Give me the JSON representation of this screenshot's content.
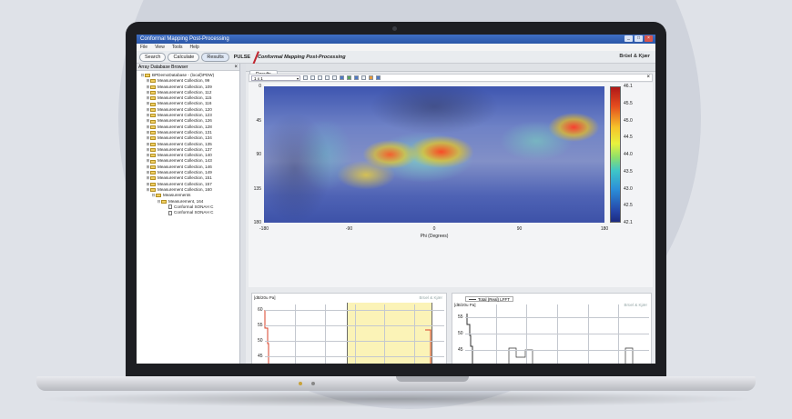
{
  "window": {
    "title": "Conformal Mapping Post-Processing",
    "buttons": {
      "minimize": "_",
      "maximize": "□",
      "close": "×"
    }
  },
  "menu": [
    "File",
    "View",
    "Tools",
    "Help"
  ],
  "toolbar": {
    "buttons": [
      "Search",
      "Calculate",
      "Results"
    ],
    "active": "Results",
    "mode_label": "PULSE",
    "app_title": "Conformal Mapping Post-Processing",
    "brand": "Brüel & Kjær"
  },
  "browser": {
    "title": "Array Database Browser",
    "close": "×",
    "root": "BPDemoDatabase - (local)\\PDW)",
    "collections": [
      "Measurement Collection, 99",
      "Measurement Collection, 109",
      "Measurement Collection, 112",
      "Measurement Collection, 115",
      "Measurement Collection, 116",
      "Measurement Collection, 120",
      "Measurement Collection, 123",
      "Measurement Collection, 126",
      "Measurement Collection, 128",
      "Measurement Collection, 131",
      "Measurement Collection, 134",
      "Measurement Collection, 135",
      "Measurement Collection, 137",
      "Measurement Collection, 140",
      "Measurement Collection, 143",
      "Measurement Collection, 146",
      "Measurement Collection, 149",
      "Measurement Collection, 151",
      "Measurement Collection, 157",
      "Measurement Collection, 160"
    ],
    "measurements_label": "Measurements",
    "measurement": "Measurement, 164",
    "files": [
      "Conformal SONAH C",
      "Conformal SONAH C"
    ]
  },
  "results": {
    "tab_label": "Results",
    "select_value": "1 x 1",
    "close": "×"
  },
  "heatmap": {
    "x_ticks": [
      "-180",
      "-90",
      "0",
      "90",
      "180"
    ],
    "x_label": "Phi (Degrees)",
    "y_ticks": [
      "0",
      "45",
      "90",
      "135",
      "180"
    ],
    "colorbar": [
      "46.1",
      "45.5",
      "45.0",
      "44.5",
      "44.0",
      "43.5",
      "43.0",
      "42.5",
      "42.1"
    ],
    "colors": {
      "high": "#b01818",
      "mid": "#e8f23e",
      "low": "#1c2b80"
    }
  },
  "bottom_left": {
    "y_label": "[dB/20u Pa]",
    "watermark": "Brüel & Kjær",
    "y_ticks": [
      "60",
      "55",
      "50",
      "45"
    ]
  },
  "bottom_right": {
    "legend": "Total (Real) LFFT",
    "y_label": "[dB/20u Pa]",
    "watermark": "Brüel & Kjær",
    "y_ticks": [
      "55",
      "50",
      "45"
    ]
  }
}
